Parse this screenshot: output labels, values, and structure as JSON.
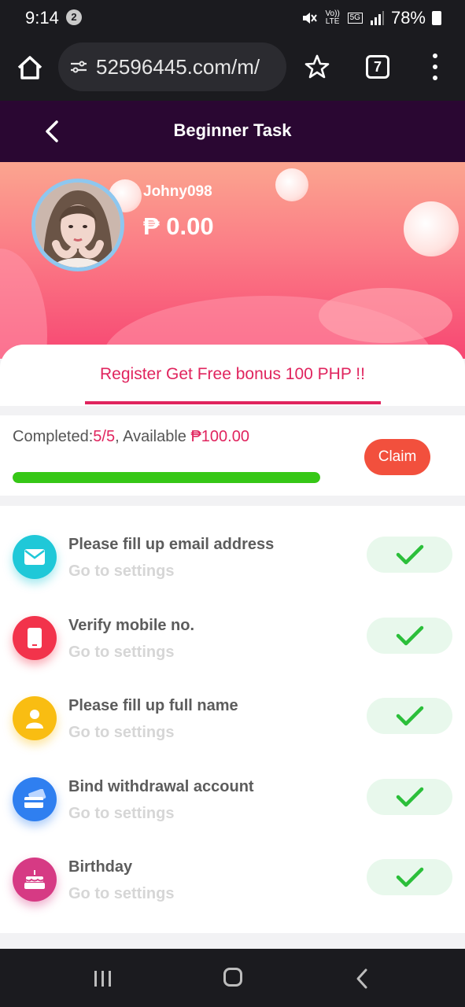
{
  "status_bar": {
    "time": "9:14",
    "notification_count": "2",
    "volte_label": "Vo)) LTE",
    "network_label": "5G",
    "battery": "78%"
  },
  "browser": {
    "url": "52596445.com/m/",
    "tab_count": "7"
  },
  "header": {
    "title": "Beginner Task"
  },
  "profile": {
    "username": "Johny098",
    "balance": "₱ 0.00"
  },
  "tab": {
    "label": "Register Get Free bonus 100 PHP !!"
  },
  "summary": {
    "completed_label": "Completed:",
    "completed_value": "5/5",
    "available_label": ", Available ",
    "available_value": "₱100.00",
    "claim_label": "Claim",
    "progress": 1.0
  },
  "tasks": [
    {
      "title": "Please fill up email address",
      "subtitle": "Go to settings",
      "icon": "envelope-icon",
      "color": "#1fc8d8"
    },
    {
      "title": "Verify mobile no.",
      "subtitle": "Go to settings",
      "icon": "phone-icon",
      "color": "#f2334b"
    },
    {
      "title": "Please fill up full name",
      "subtitle": "Go to settings",
      "icon": "person-icon",
      "color": "#f9bd12"
    },
    {
      "title": "Bind withdrawal account",
      "subtitle": "Go to settings",
      "icon": "card-icon",
      "color": "#2f7ff0"
    },
    {
      "title": "Birthday",
      "subtitle": "Go to settings",
      "icon": "cake-icon",
      "color": "#d63a84"
    }
  ],
  "colors": {
    "accent": "#e0245e",
    "header_bg": "#2a0732",
    "claim_bg": "#f2503d",
    "progress": "#36c716",
    "check": "#2bbf3a"
  }
}
